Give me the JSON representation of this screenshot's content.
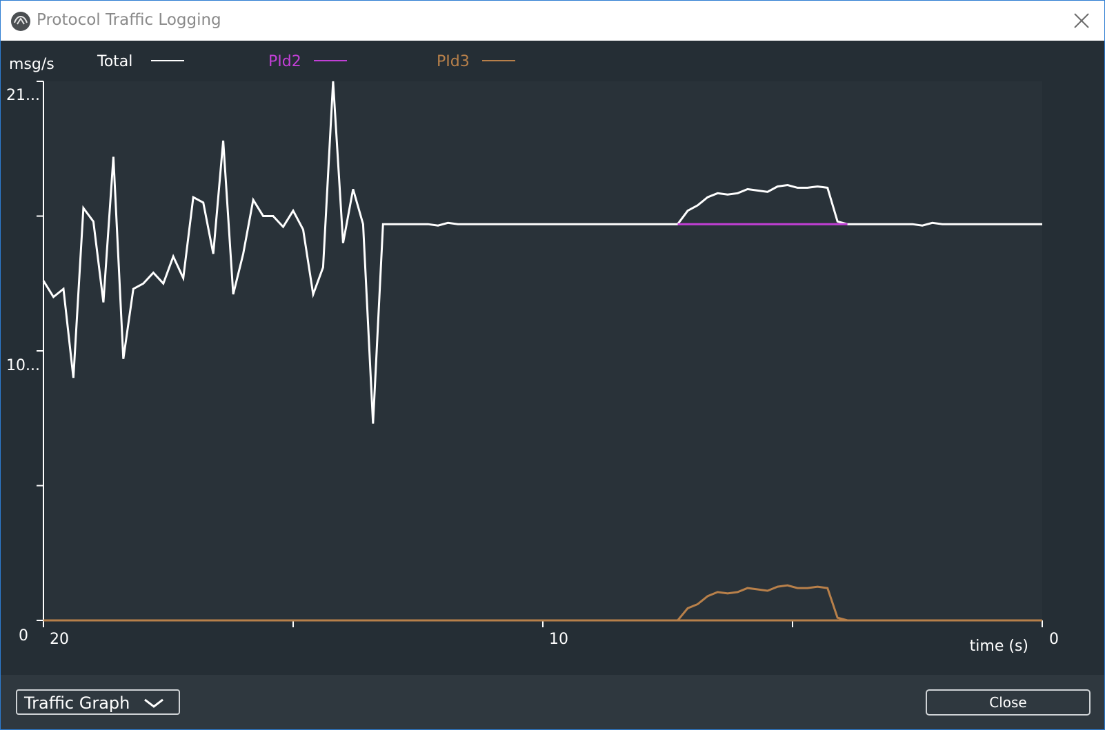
{
  "window": {
    "title": "Protocol Traffic Logging"
  },
  "footer": {
    "view_select_value": "Traffic Graph",
    "close_label": "Close"
  },
  "colors": {
    "titlebar_bg": "#ffffff",
    "plot_bg": "#293239",
    "total": "#ffffff",
    "pid2": "#c23fd6",
    "pid3": "#b8804a"
  },
  "chart_data": {
    "type": "line",
    "ylabel": "msg/s",
    "xlabel": "time (s)",
    "y_tick_labels": [
      "21...",
      "10...",
      "0"
    ],
    "x_tick_labels": [
      "20",
      "10",
      "0"
    ],
    "xlim": [
      20,
      0
    ],
    "ylim": [
      0,
      20
    ],
    "series": [
      {
        "name": "Total",
        "color": "#ffffff",
        "points": [
          [
            20.0,
            12.6
          ],
          [
            19.8,
            12.0
          ],
          [
            19.6,
            12.3
          ],
          [
            19.4,
            9.0
          ],
          [
            19.2,
            15.3
          ],
          [
            19.0,
            14.8
          ],
          [
            18.8,
            11.8
          ],
          [
            18.6,
            17.2
          ],
          [
            18.4,
            9.7
          ],
          [
            18.2,
            12.3
          ],
          [
            18.0,
            12.5
          ],
          [
            17.8,
            12.9
          ],
          [
            17.6,
            12.5
          ],
          [
            17.4,
            13.5
          ],
          [
            17.2,
            12.7
          ],
          [
            17.0,
            15.7
          ],
          [
            16.8,
            15.5
          ],
          [
            16.6,
            13.6
          ],
          [
            16.4,
            17.8
          ],
          [
            16.2,
            12.1
          ],
          [
            16.0,
            13.6
          ],
          [
            15.8,
            15.6
          ],
          [
            15.6,
            15.0
          ],
          [
            15.4,
            15.0
          ],
          [
            15.2,
            14.6
          ],
          [
            15.0,
            15.2
          ],
          [
            14.8,
            14.5
          ],
          [
            14.6,
            12.1
          ],
          [
            14.4,
            13.1
          ],
          [
            14.2,
            20.0
          ],
          [
            14.0,
            14.0
          ],
          [
            13.8,
            16.0
          ],
          [
            13.6,
            14.7
          ],
          [
            13.4,
            7.3
          ],
          [
            13.2,
            14.7
          ],
          [
            12.9,
            14.7
          ],
          [
            12.5,
            14.7
          ],
          [
            12.3,
            14.7
          ],
          [
            12.1,
            14.65
          ],
          [
            11.9,
            14.75
          ],
          [
            11.7,
            14.7
          ],
          [
            11.0,
            14.7
          ],
          [
            10.0,
            14.7
          ],
          [
            9.0,
            14.7
          ],
          [
            7.3,
            14.7
          ],
          [
            7.1,
            15.2
          ],
          [
            6.9,
            15.4
          ],
          [
            6.7,
            15.7
          ],
          [
            6.5,
            15.85
          ],
          [
            6.3,
            15.8
          ],
          [
            6.1,
            15.85
          ],
          [
            5.9,
            16.0
          ],
          [
            5.7,
            15.95
          ],
          [
            5.5,
            15.9
          ],
          [
            5.3,
            16.1
          ],
          [
            5.1,
            16.15
          ],
          [
            4.9,
            16.05
          ],
          [
            4.7,
            16.05
          ],
          [
            4.5,
            16.1
          ],
          [
            4.3,
            16.05
          ],
          [
            4.1,
            14.8
          ],
          [
            3.9,
            14.7
          ],
          [
            3.0,
            14.7
          ],
          [
            2.6,
            14.7
          ],
          [
            2.4,
            14.65
          ],
          [
            2.2,
            14.75
          ],
          [
            2.0,
            14.7
          ],
          [
            1.0,
            14.7
          ],
          [
            0.0,
            14.7
          ]
        ]
      },
      {
        "name": "PId2",
        "color": "#c23fd6",
        "points": [
          [
            7.3,
            14.7
          ],
          [
            3.9,
            14.7
          ]
        ]
      },
      {
        "name": "PId3",
        "color": "#b8804a",
        "points": [
          [
            20.0,
            0.0
          ],
          [
            7.3,
            0.0
          ],
          [
            7.1,
            0.45
          ],
          [
            6.9,
            0.6
          ],
          [
            6.7,
            0.9
          ],
          [
            6.5,
            1.05
          ],
          [
            6.3,
            1.0
          ],
          [
            6.1,
            1.05
          ],
          [
            5.9,
            1.2
          ],
          [
            5.7,
            1.15
          ],
          [
            5.5,
            1.1
          ],
          [
            5.3,
            1.25
          ],
          [
            5.1,
            1.3
          ],
          [
            4.9,
            1.2
          ],
          [
            4.7,
            1.2
          ],
          [
            4.5,
            1.25
          ],
          [
            4.3,
            1.2
          ],
          [
            4.1,
            0.1
          ],
          [
            3.9,
            0.0
          ],
          [
            0.0,
            0.0
          ]
        ]
      }
    ]
  }
}
